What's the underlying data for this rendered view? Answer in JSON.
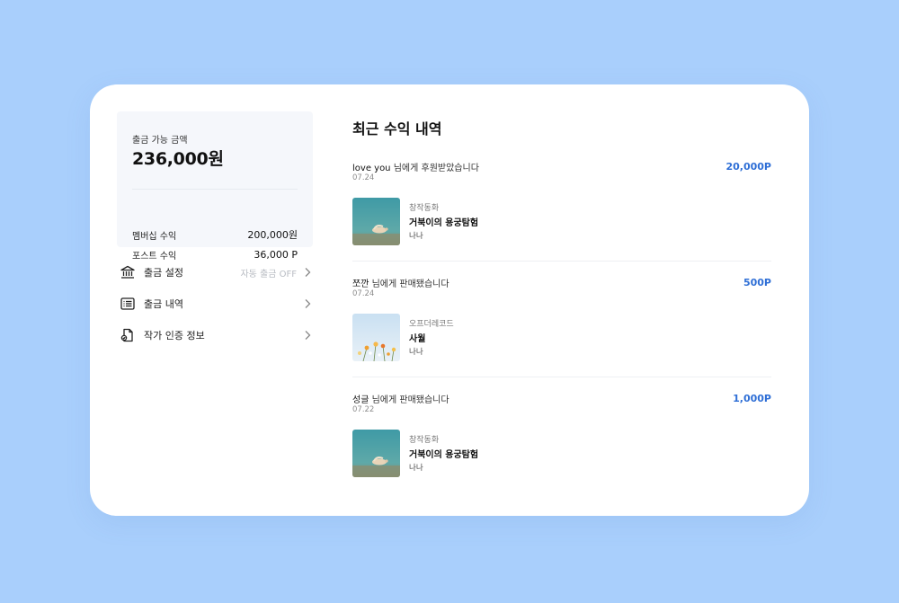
{
  "balance": {
    "label": "출금 가능 금액",
    "amount": "236,000원",
    "rows": [
      {
        "label": "멤버십 수익",
        "value": "200,000원"
      },
      {
        "label": "포스트 수익",
        "value": "36,000 P"
      }
    ]
  },
  "menu": [
    {
      "label": "출금 설정",
      "status": "자동 출금 OFF",
      "icon": "bank-icon"
    },
    {
      "label": "출금 내역",
      "status": "",
      "icon": "list-icon"
    },
    {
      "label": "작가 인증 정보",
      "status": "",
      "icon": "document-icon"
    }
  ],
  "earnings": {
    "title": "최근 수익 내역",
    "items": [
      {
        "user": "love you",
        "message": "님에게 후원받았습니다",
        "date": "07.24",
        "amount": "20,000P",
        "genre": "창작동화",
        "book_title": "거북이의 용궁탐험",
        "author": "나나",
        "thumb": "turtle-underwater-image"
      },
      {
        "user": "쪼깐",
        "message": "님에게 판매됐습니다",
        "date": "07.24",
        "amount": "500P",
        "genre": "오프더레코드",
        "book_title": "사월",
        "author": "나나",
        "thumb": "flowers-sky-image"
      },
      {
        "user": "성글",
        "message": "님에게 판매됐습니다",
        "date": "07.22",
        "amount": "1,000P",
        "genre": "창작동화",
        "book_title": "거북이의 용궁탐험",
        "author": "나나",
        "thumb": "turtle-underwater-image"
      }
    ]
  },
  "colors": {
    "background": "#a9cffc",
    "accent": "#2f6fd6",
    "panel": "#f5f7fb"
  }
}
